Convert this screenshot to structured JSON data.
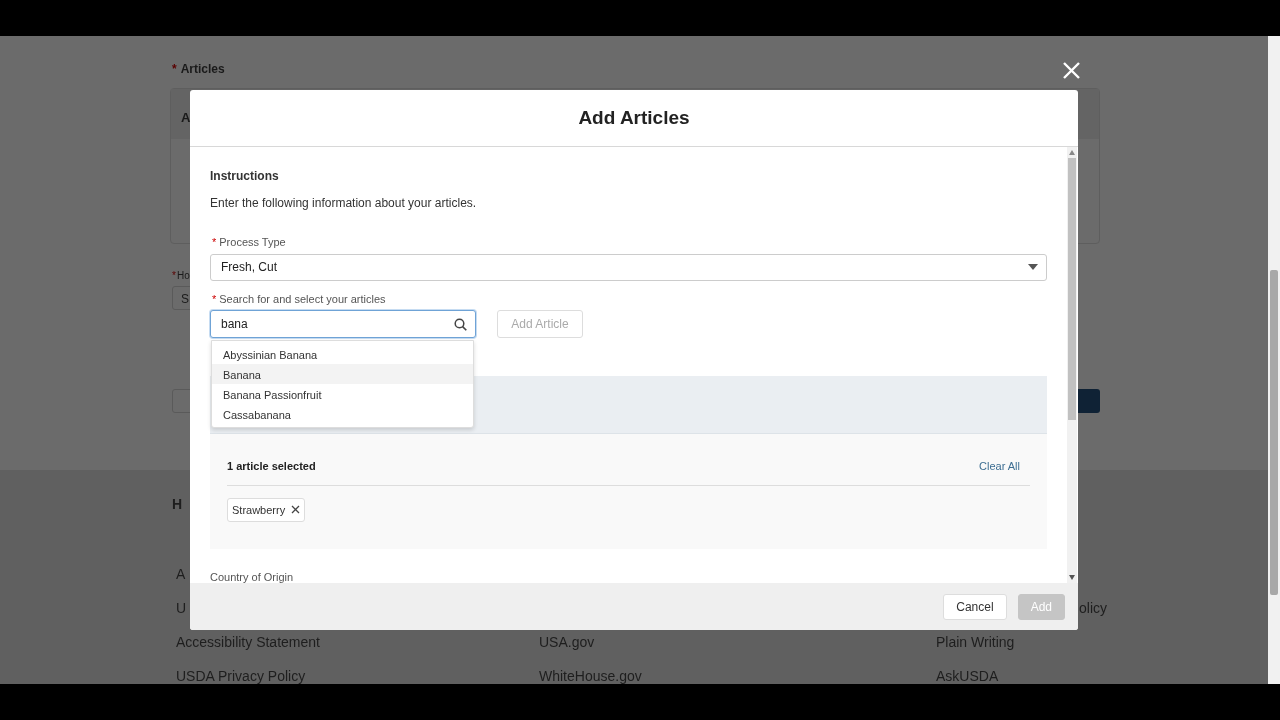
{
  "background_page": {
    "articles_label": {
      "mark": "*",
      "text": "Articles"
    },
    "card_heading": "A",
    "hours_label": {
      "mark": "*",
      "text": "Ho"
    },
    "hours_field_value": "S",
    "footer_heading": "H",
    "footer_columns": [
      {
        "links": [
          "A",
          "U",
          "Accessibility Statement",
          "USDA Privacy Policy"
        ]
      },
      {
        "links": [
          "USA.gov",
          "WhiteHouse.gov"
        ]
      },
      {
        "links": [
          "olicy",
          "Plain Writing",
          "AskUSDA"
        ]
      }
    ]
  },
  "modal": {
    "title": "Add Articles",
    "instructions_heading": "Instructions",
    "instructions_text": "Enter the following information about your articles.",
    "process_type": {
      "label": {
        "mark": "*",
        "text": "Process Type"
      },
      "value": "Fresh, Cut"
    },
    "article_search": {
      "label": {
        "mark": "*",
        "text": "Search for and select your articles"
      },
      "value": "bana",
      "focused": true
    },
    "add_article_button": {
      "label": "Add Article",
      "disabled": true
    },
    "suggestions": [
      {
        "text": "Abyssinian Banana",
        "highlighted": false
      },
      {
        "text": "Banana",
        "highlighted": true
      },
      {
        "text": "Banana Passionfruit",
        "highlighted": false
      },
      {
        "text": "Cassabanana",
        "highlighted": false
      }
    ],
    "selected_summary": "1 article selected",
    "clear_all": "Clear All",
    "selected_articles": [
      {
        "label": "Strawberry"
      }
    ],
    "country_label": "Country of Origin",
    "buttons": [
      {
        "label": "Cancel",
        "disabled": false
      },
      {
        "label": "Add",
        "disabled": true
      }
    ]
  }
}
